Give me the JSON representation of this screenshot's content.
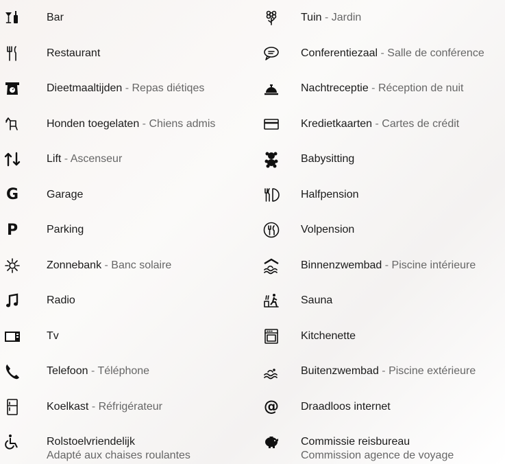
{
  "left": [
    {
      "icon": "bar-icon",
      "nl": "Bar",
      "fr": ""
    },
    {
      "icon": "restaurant-cutlery-icon",
      "nl": "Restaurant",
      "fr": ""
    },
    {
      "icon": "scale-icon",
      "nl": "Dieetmaaltijden",
      "fr": "Repas diétiqes"
    },
    {
      "icon": "dog-icon",
      "nl": "Honden toegelaten",
      "fr": "Chiens admis"
    },
    {
      "icon": "lift-arrows-icon",
      "nl": "Lift",
      "fr": "Ascenseur"
    },
    {
      "icon": "garage-g-icon",
      "nl": "Garage",
      "fr": "",
      "glyph": "G"
    },
    {
      "icon": "parking-p-icon",
      "nl": "Parking",
      "fr": "",
      "glyph": "P"
    },
    {
      "icon": "sun-icon",
      "nl": "Zonnebank",
      "fr": "Banc solaire"
    },
    {
      "icon": "music-note-icon",
      "nl": "Radio",
      "fr": ""
    },
    {
      "icon": "tv-icon",
      "nl": "Tv",
      "fr": ""
    },
    {
      "icon": "phone-icon",
      "nl": "Telefoon",
      "fr": "Téléphone"
    },
    {
      "icon": "fridge-icon",
      "nl": "Koelkast",
      "fr": "Réfrigérateur"
    },
    {
      "icon": "wheelchair-icon",
      "nl": "Rolstoelvriendelijk",
      "fr": "Adapté aux chaises roulantes"
    }
  ],
  "right": [
    {
      "icon": "flower-icon",
      "nl": "Tuin",
      "fr": "Jardin"
    },
    {
      "icon": "speech-bubble-icon",
      "nl": "Conferentiezaal",
      "fr": "Salle de conférence"
    },
    {
      "icon": "reception-bell-icon",
      "nl": "Nachtreceptie",
      "fr": "Réception de nuit"
    },
    {
      "icon": "credit-card-icon",
      "nl": "Kredietkaarten",
      "fr": "Cartes de crédit"
    },
    {
      "icon": "teddy-bear-icon",
      "nl": "Babysitting",
      "fr": ""
    },
    {
      "icon": "half-board-icon",
      "nl": "Halfpension",
      "fr": ""
    },
    {
      "icon": "full-board-icon",
      "nl": "Volpension",
      "fr": ""
    },
    {
      "icon": "indoor-pool-icon",
      "nl": "Binnenzwembad",
      "fr": "Piscine intérieure"
    },
    {
      "icon": "sauna-icon",
      "nl": "Sauna",
      "fr": ""
    },
    {
      "icon": "kitchenette-icon",
      "nl": "Kitchenette",
      "fr": ""
    },
    {
      "icon": "outdoor-pool-icon",
      "nl": "Buitenzwembad",
      "fr": "Piscine extérieure"
    },
    {
      "icon": "at-sign-icon",
      "nl": "Draadloos internet",
      "fr": "",
      "glyph": "@"
    },
    {
      "icon": "piggy-bank-icon",
      "nl": "Commissie reisbureau",
      "fr": "Commission agence de voyage"
    }
  ],
  "separator": " - "
}
